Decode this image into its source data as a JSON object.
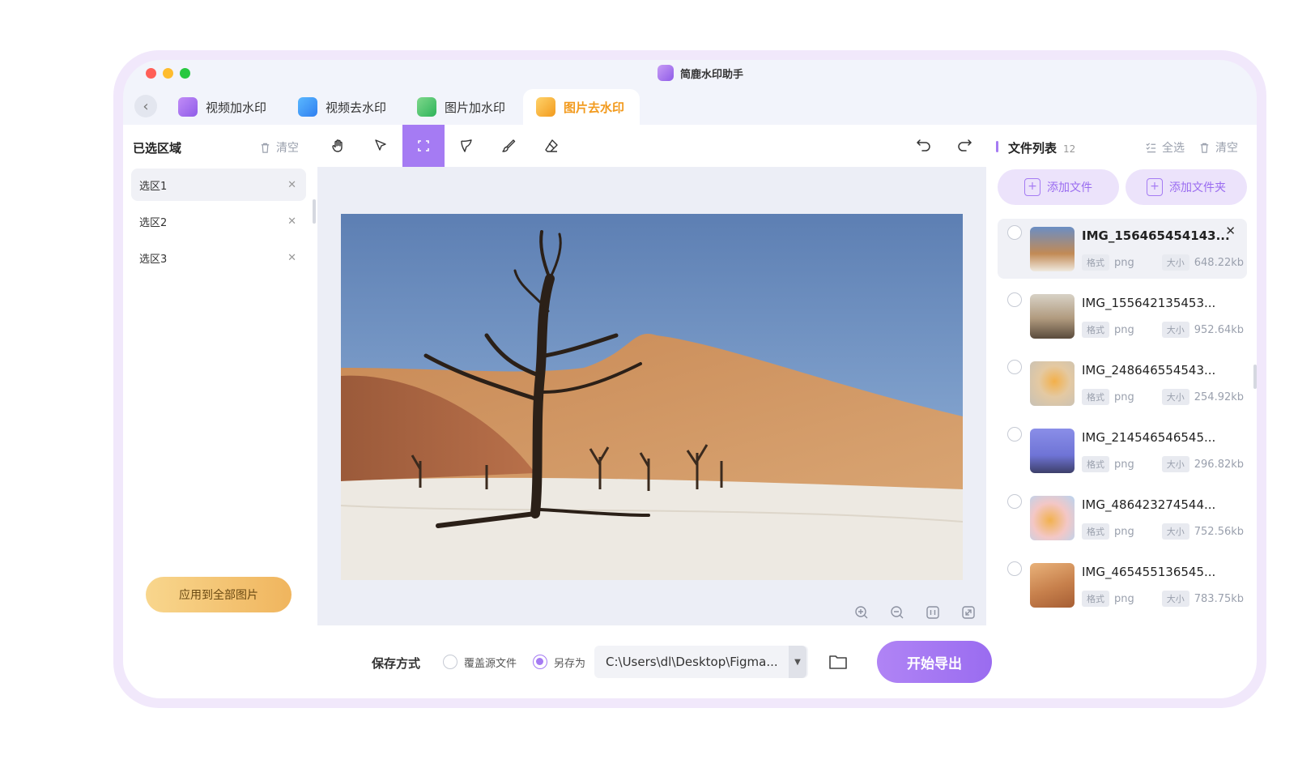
{
  "app": {
    "title": "简鹿水印助手"
  },
  "tabs": [
    {
      "label": "视频加水印",
      "icon": "video-watermark-icon"
    },
    {
      "label": "视频去水印",
      "icon": "video-remove-watermark-icon"
    },
    {
      "label": "图片加水印",
      "icon": "image-watermark-icon"
    },
    {
      "label": "图片去水印",
      "icon": "image-remove-watermark-icon",
      "active": true
    }
  ],
  "left_panel": {
    "title": "已选区域",
    "clear_label": "清空",
    "selections": [
      "选区1",
      "选区2",
      "选区3"
    ],
    "apply_label": "应用到全部图片"
  },
  "toolbar": {
    "tools": [
      "hand-icon",
      "pointer-icon",
      "rect-select-icon",
      "lasso-icon",
      "brush-icon",
      "eraser-icon"
    ],
    "active_tool": "rect-select-icon",
    "undo": "undo-icon",
    "redo": "redo-icon"
  },
  "canvas": {
    "zoom_controls": [
      "zoom-in-icon",
      "zoom-out-icon",
      "actual-size-icon",
      "fit-screen-icon"
    ]
  },
  "save": {
    "label": "保存方式",
    "option_overwrite": "覆盖源文件",
    "option_save_as": "另存为",
    "selected": "另存为",
    "path": "C:\\Users\\dl\\Desktop\\Figma...",
    "export_label": "开始导出"
  },
  "right_panel": {
    "title": "文件列表",
    "count": "12",
    "select_all_label": "全选",
    "clear_label": "清空",
    "add_file_label": "添加文件",
    "add_folder_label": "添加文件夹",
    "format_tag": "格式",
    "size_tag": "大小",
    "files": [
      {
        "name": "IMG_156465454143...",
        "format": "png",
        "size": "648.22kb"
      },
      {
        "name": "IMG_155642135453...",
        "format": "png",
        "size": "952.64kb"
      },
      {
        "name": "IMG_248646554543...",
        "format": "png",
        "size": "254.92kb"
      },
      {
        "name": "IMG_214546546545...",
        "format": "png",
        "size": "296.82kb"
      },
      {
        "name": "IMG_486423274544...",
        "format": "png",
        "size": "752.56kb"
      },
      {
        "name": "IMG_465455136545...",
        "format": "png",
        "size": "783.75kb"
      }
    ]
  },
  "colors": {
    "accent": "#a57bf3",
    "active_tab": "#f29a1d",
    "apply_button": "#f0b55e"
  }
}
